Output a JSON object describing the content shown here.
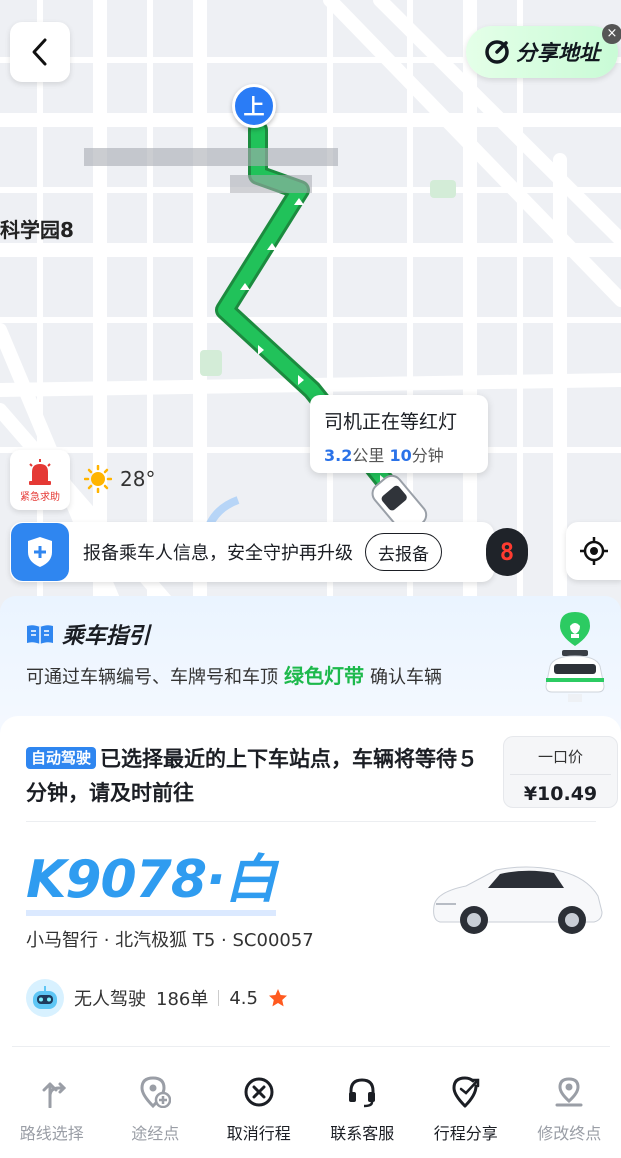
{
  "map": {
    "place_label": "科学园8",
    "pickup_pin": "上",
    "share": {
      "label": "分享地址"
    },
    "status": {
      "title": "司机正在等红灯",
      "distance": "3.2",
      "distance_unit": "公里",
      "minutes": "10",
      "minutes_unit": "分钟"
    },
    "sos_label": "紧急求助",
    "weather": {
      "temp": "28°",
      "icon": "sun-icon"
    },
    "report": {
      "text": "报备乘车人信息，安全守护再升级",
      "button": "去报备"
    },
    "counter": "8"
  },
  "guide": {
    "title": "乘车指引",
    "desc_before": "可通过车辆编号、车牌号和车顶",
    "desc_highlight": "绿色灯带",
    "desc_after": "确认车辆",
    "highlight_color": "#1db94c"
  },
  "trip": {
    "badge": "自动驾驶",
    "notice": "已选择最近的上下车站点，车辆将等待５分钟，请及时前往",
    "price_label": "一口价",
    "price": "¥10.49",
    "plate": "K9078·白",
    "model": "小马智行 · 北汽极狐 T5 · SC00057",
    "driver": "无人驾驶",
    "orders": "186单",
    "rating": "4.5"
  },
  "actions": [
    {
      "label": "路线选择",
      "icon": "route-icon",
      "enabled": false
    },
    {
      "label": "途经点",
      "icon": "waypoint-add-icon",
      "enabled": false
    },
    {
      "label": "取消行程",
      "icon": "cancel-circle-icon",
      "enabled": true
    },
    {
      "label": "联系客服",
      "icon": "headset-icon",
      "enabled": true
    },
    {
      "label": "行程分享",
      "icon": "share-location-icon",
      "enabled": true
    },
    {
      "label": "修改终点",
      "icon": "location-pin-icon",
      "enabled": false
    }
  ],
  "colors": {
    "accent": "#2f86f0",
    "route": "#1db94c",
    "plate": "#2f9cf0"
  }
}
